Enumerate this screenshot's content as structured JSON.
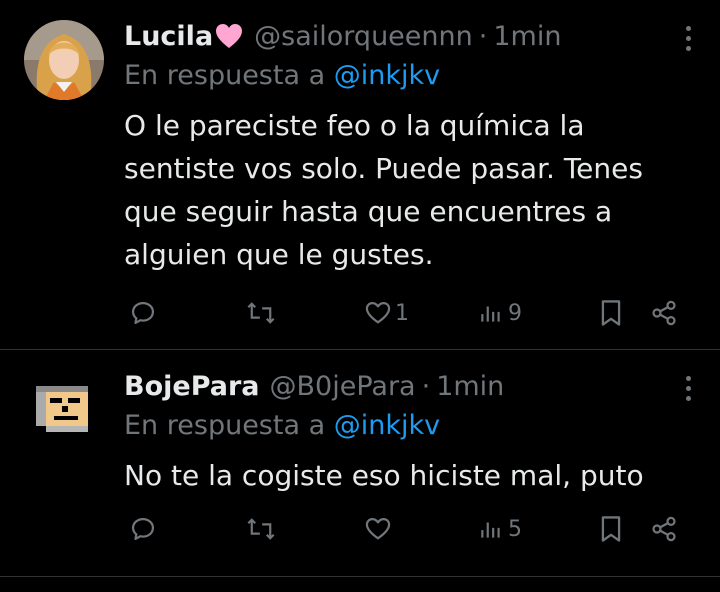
{
  "tweets": [
    {
      "name": "Lucila",
      "emoji": "pink-heart",
      "handle": "@sailorqueennn",
      "separator": "·",
      "time": "1min",
      "reply_prefix": "En respuesta a",
      "reply_handle": "@inkjkv",
      "body": "O le pareciste feo o la química la sentiste vos solo. Puede pasar. Tenes que seguir hasta que encuentres a alguien que le gustes.",
      "likes": "1",
      "views": "9"
    },
    {
      "name": "BojePara",
      "handle": "@B0jePara",
      "separator": "·",
      "time": "1min",
      "reply_prefix": "En respuesta a",
      "reply_handle": "@inkjkv",
      "body": "No te la cogiste eso hiciste mal, puto",
      "likes": "",
      "views": "5"
    }
  ],
  "colors": {
    "background": "#000000",
    "text": "#e7e9ea",
    "muted": "#71767b",
    "link": "#1d9bf0",
    "divider": "#2f3336"
  },
  "icons": [
    "reply-icon",
    "retweet-icon",
    "like-icon",
    "views-icon",
    "bookmark-icon",
    "share-icon",
    "more-icon"
  ]
}
